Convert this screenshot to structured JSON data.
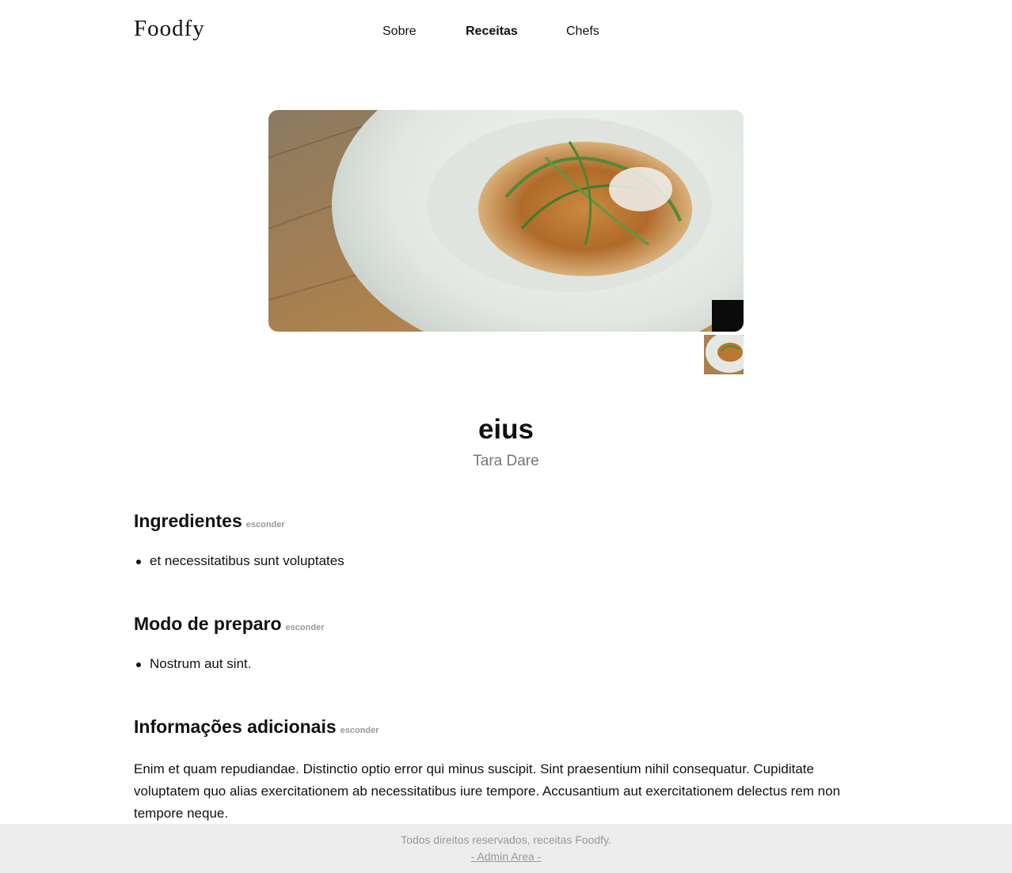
{
  "header": {
    "logo": "Foodfy",
    "nav": [
      {
        "label": "Sobre",
        "active": false
      },
      {
        "label": "Receitas",
        "active": true
      },
      {
        "label": "Chefs",
        "active": false
      }
    ]
  },
  "recipe": {
    "title": "eius",
    "author": "Tara Dare"
  },
  "sections": {
    "ingredients": {
      "heading": "Ingredientes",
      "toggle": "esconder",
      "items": [
        "et necessitatibus sunt voluptates"
      ]
    },
    "preparation": {
      "heading": "Modo de preparo",
      "toggle": "esconder",
      "items": [
        "Nostrum aut sint."
      ]
    },
    "information": {
      "heading": "Informações adicionais",
      "toggle": "esconder",
      "text": "Enim et quam repudiandae. Distinctio optio error qui minus suscipit. Sint praesentium nihil consequatur. Cupiditate voluptatem quo alias exercitationem ab necessitatibus iure tempore. Accusantium aut exercitationem delectus rem non tempore neque."
    }
  },
  "footer": {
    "copyright": "Todos direitos reservados, receitas Foodfy.",
    "admin_link": "- Admin Area -"
  }
}
